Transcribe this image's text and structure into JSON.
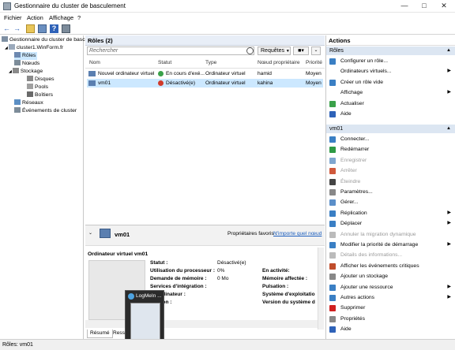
{
  "window": {
    "title": "Gestionnaire du cluster de basculement"
  },
  "menu": [
    "Fichier",
    "Action",
    "Affichage",
    "?"
  ],
  "tree": {
    "root": "Gestionnaire du cluster de basc",
    "cluster": "cluster1.WinForm.fr",
    "items": [
      "Rôles",
      "Nœuds",
      "Stockage",
      "Disques",
      "Pools",
      "Boîtiers",
      "Réseaux",
      "Événements de cluster"
    ]
  },
  "roles": {
    "header": "Rôles (2)",
    "search_placeholder": "Rechercher",
    "requests_label": "Requêtes",
    "columns": [
      "Nom",
      "Statut",
      "Type",
      "Nœud propriétaire",
      "Priorité"
    ],
    "rows": [
      {
        "name": "Nouvel ordinateur virtuel",
        "status": "En cours d'exé...",
        "type": "Ordinateur virtuel",
        "owner": "hamid",
        "priority": "Moyen"
      },
      {
        "name": "vm01",
        "status": "Désactivé(e)",
        "type": "Ordinateur virtuel",
        "owner": "kahina",
        "priority": "Moyen"
      }
    ]
  },
  "detail": {
    "name": "vm01",
    "preferred_owners_label": "Propriétaires favoris :",
    "preferred_owners_link": "N'importe quel nœud",
    "section_title": "Ordinateur virtuel vm01",
    "left": [
      {
        "label": "Statut :",
        "value": "Désactivé(e)"
      },
      {
        "label": "Utilisation du processeur :",
        "value": "0%"
      },
      {
        "label": "Demande de mémoire :",
        "value": "0 Mo"
      },
      {
        "label": "Services d'intégration :",
        "value": ""
      },
      {
        "label": "...l'ordinateur :",
        "value": ""
      },
      {
        "label": "...ration :",
        "value": ""
      }
    ],
    "right": [
      {
        "label": "En activité:",
        "value": ""
      },
      {
        "label": "Mémoire affectée :",
        "value": ""
      },
      {
        "label": "Pulsation :",
        "value": ""
      },
      {
        "label": "Système d'exploitatio",
        "value": ""
      },
      {
        "label": "Version du système d",
        "value": ""
      }
    ],
    "tabs": [
      "Résumé",
      "Resso"
    ]
  },
  "taskbar_preview": {
    "label": "LogMeIn ..."
  },
  "actions": {
    "header": "Actions",
    "roles_section": "Rôles",
    "roles_items": [
      {
        "label": "Configurer un rôle...",
        "arrow": false,
        "disabled": false,
        "color": "#3a7fc4"
      },
      {
        "label": "Ordinateurs virtuels...",
        "arrow": true,
        "disabled": false,
        "color": ""
      },
      {
        "label": "Créer un rôle vide",
        "arrow": false,
        "disabled": false,
        "color": "#3a7fc4"
      },
      {
        "label": "Affichage",
        "arrow": true,
        "disabled": false,
        "color": ""
      },
      {
        "label": "Actualiser",
        "arrow": false,
        "disabled": false,
        "color": "#3aa14a"
      },
      {
        "label": "Aide",
        "arrow": false,
        "disabled": false,
        "color": "#2e62b8"
      }
    ],
    "vm_section": "vm01",
    "vm_items": [
      {
        "label": "Connecter...",
        "arrow": false,
        "disabled": false,
        "color": "#3a7fc4"
      },
      {
        "label": "Redémarrer",
        "arrow": false,
        "disabled": false,
        "color": "#2e9a45"
      },
      {
        "label": "Enregistrer",
        "arrow": false,
        "disabled": true,
        "color": "#7fa7d0"
      },
      {
        "label": "Arrêter",
        "arrow": false,
        "disabled": true,
        "color": "#d0593c"
      },
      {
        "label": "Éteindre",
        "arrow": false,
        "disabled": true,
        "color": "#444444"
      },
      {
        "label": "Paramètres...",
        "arrow": false,
        "disabled": false,
        "color": "#888888"
      },
      {
        "label": "Gérer...",
        "arrow": false,
        "disabled": false,
        "color": "#5b8fc9"
      },
      {
        "label": "Réplication",
        "arrow": true,
        "disabled": false,
        "color": "#3a7fc4"
      },
      {
        "label": "Déplacer",
        "arrow": true,
        "disabled": false,
        "color": "#3a7fc4"
      },
      {
        "label": "Annuler la migration dynamique",
        "arrow": false,
        "disabled": true,
        "color": "#bbbbbb"
      },
      {
        "label": "Modifier la priorité de démarrage",
        "arrow": true,
        "disabled": false,
        "color": "#3a7fc4"
      },
      {
        "label": "Détails des informations...",
        "arrow": false,
        "disabled": true,
        "color": "#bbbbbb"
      },
      {
        "label": "Afficher les événements critiques",
        "arrow": false,
        "disabled": false,
        "color": "#c04d2c"
      },
      {
        "label": "Ajouter un stockage",
        "arrow": false,
        "disabled": false,
        "color": "#888888"
      },
      {
        "label": "Ajouter une ressource",
        "arrow": true,
        "disabled": false,
        "color": "#3a7fc4"
      },
      {
        "label": "Autres actions",
        "arrow": true,
        "disabled": false,
        "color": "#3a7fc4"
      },
      {
        "label": "Supprimer",
        "arrow": false,
        "disabled": false,
        "color": "#d02020"
      },
      {
        "label": "Propriétés",
        "arrow": false,
        "disabled": false,
        "color": "#888888"
      },
      {
        "label": "Aide",
        "arrow": false,
        "disabled": false,
        "color": "#2e62b8"
      }
    ]
  },
  "status": "Rôles: vm01"
}
